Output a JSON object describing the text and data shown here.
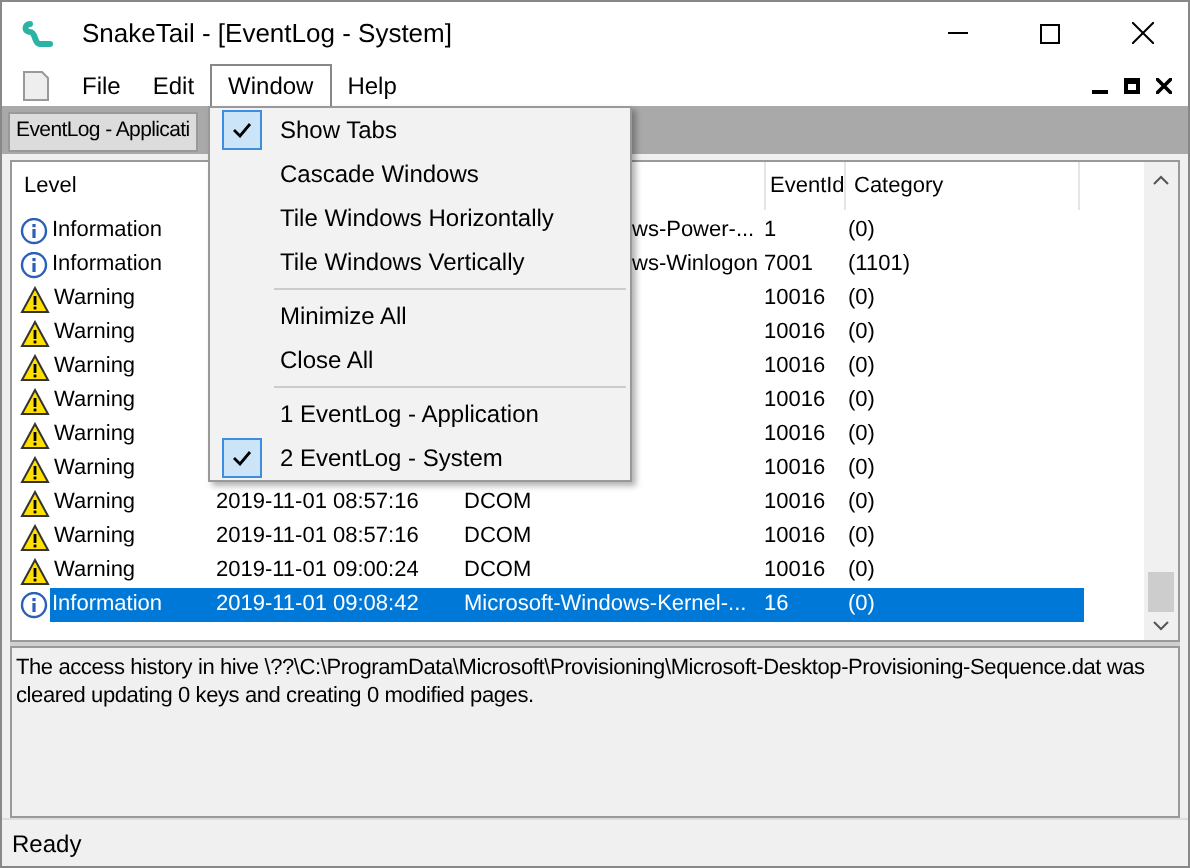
{
  "window": {
    "title": "SnakeTail - [EventLog - System]"
  },
  "menu_bar": [
    {
      "label": "File",
      "selected": false
    },
    {
      "label": "Edit",
      "selected": false
    },
    {
      "label": "Window",
      "selected": true
    },
    {
      "label": "Help",
      "selected": false
    }
  ],
  "tabs": [
    {
      "label": "EventLog - Applicati",
      "selected": false
    }
  ],
  "table": {
    "columns": [
      "Level",
      "EventId",
      "Category"
    ],
    "rows": [
      {
        "kind": "info",
        "level": "Information",
        "date": "",
        "source": "ws-Power-...",
        "event_id": "1",
        "category": "(0)",
        "selected": false
      },
      {
        "kind": "info",
        "level": "Information",
        "date": "",
        "source": "ws-Winlogon",
        "event_id": "7001",
        "category": "(1101)",
        "selected": false
      },
      {
        "kind": "warning",
        "level": "Warning",
        "date": "",
        "source": "",
        "event_id": "10016",
        "category": "(0)",
        "selected": false
      },
      {
        "kind": "warning",
        "level": "Warning",
        "date": "",
        "source": "",
        "event_id": "10016",
        "category": "(0)",
        "selected": false
      },
      {
        "kind": "warning",
        "level": "Warning",
        "date": "",
        "source": "",
        "event_id": "10016",
        "category": "(0)",
        "selected": false
      },
      {
        "kind": "warning",
        "level": "Warning",
        "date": "",
        "source": "",
        "event_id": "10016",
        "category": "(0)",
        "selected": false
      },
      {
        "kind": "warning",
        "level": "Warning",
        "date": "",
        "source": "",
        "event_id": "10016",
        "category": "(0)",
        "selected": false
      },
      {
        "kind": "warning",
        "level": "Warning",
        "date": "",
        "source": "",
        "event_id": "10016",
        "category": "(0)",
        "selected": false
      },
      {
        "kind": "warning",
        "level": "Warning",
        "date": "2019-11-01 08:57:16",
        "source": "DCOM",
        "event_id": "10016",
        "category": "(0)",
        "selected": false
      },
      {
        "kind": "warning",
        "level": "Warning",
        "date": "2019-11-01 08:57:16",
        "source": "DCOM",
        "event_id": "10016",
        "category": "(0)",
        "selected": false
      },
      {
        "kind": "warning",
        "level": "Warning",
        "date": "2019-11-01 09:00:24",
        "source": "DCOM",
        "event_id": "10016",
        "category": "(0)",
        "selected": false
      },
      {
        "kind": "info",
        "level": "Information",
        "date": "2019-11-01 09:08:42",
        "source": "Microsoft-Windows-Kernel-...",
        "event_id": "16",
        "category": "(0)",
        "selected": true
      }
    ]
  },
  "window_menu": [
    {
      "kind": "item",
      "label": "Show Tabs",
      "checked": true
    },
    {
      "kind": "item",
      "label": "Cascade Windows",
      "checked": false
    },
    {
      "kind": "item",
      "label": "Tile Windows Horizontally",
      "checked": false
    },
    {
      "kind": "item",
      "label": "Tile Windows Vertically",
      "checked": false
    },
    {
      "kind": "separator"
    },
    {
      "kind": "item",
      "label": "Minimize All",
      "checked": false
    },
    {
      "kind": "item",
      "label": "Close All",
      "checked": false
    },
    {
      "kind": "separator"
    },
    {
      "kind": "item",
      "label": "1 EventLog - Application",
      "checked": false
    },
    {
      "kind": "item",
      "label": "2 EventLog - System",
      "checked": true
    }
  ],
  "detail": "The access history in hive \\??\\C:\\ProgramData\\Microsoft\\Provisioning\\Microsoft-Desktop-Provisioning-Sequence.dat was cleared updating 0 keys and creating 0 modified pages.",
  "status_bar": "Ready"
}
